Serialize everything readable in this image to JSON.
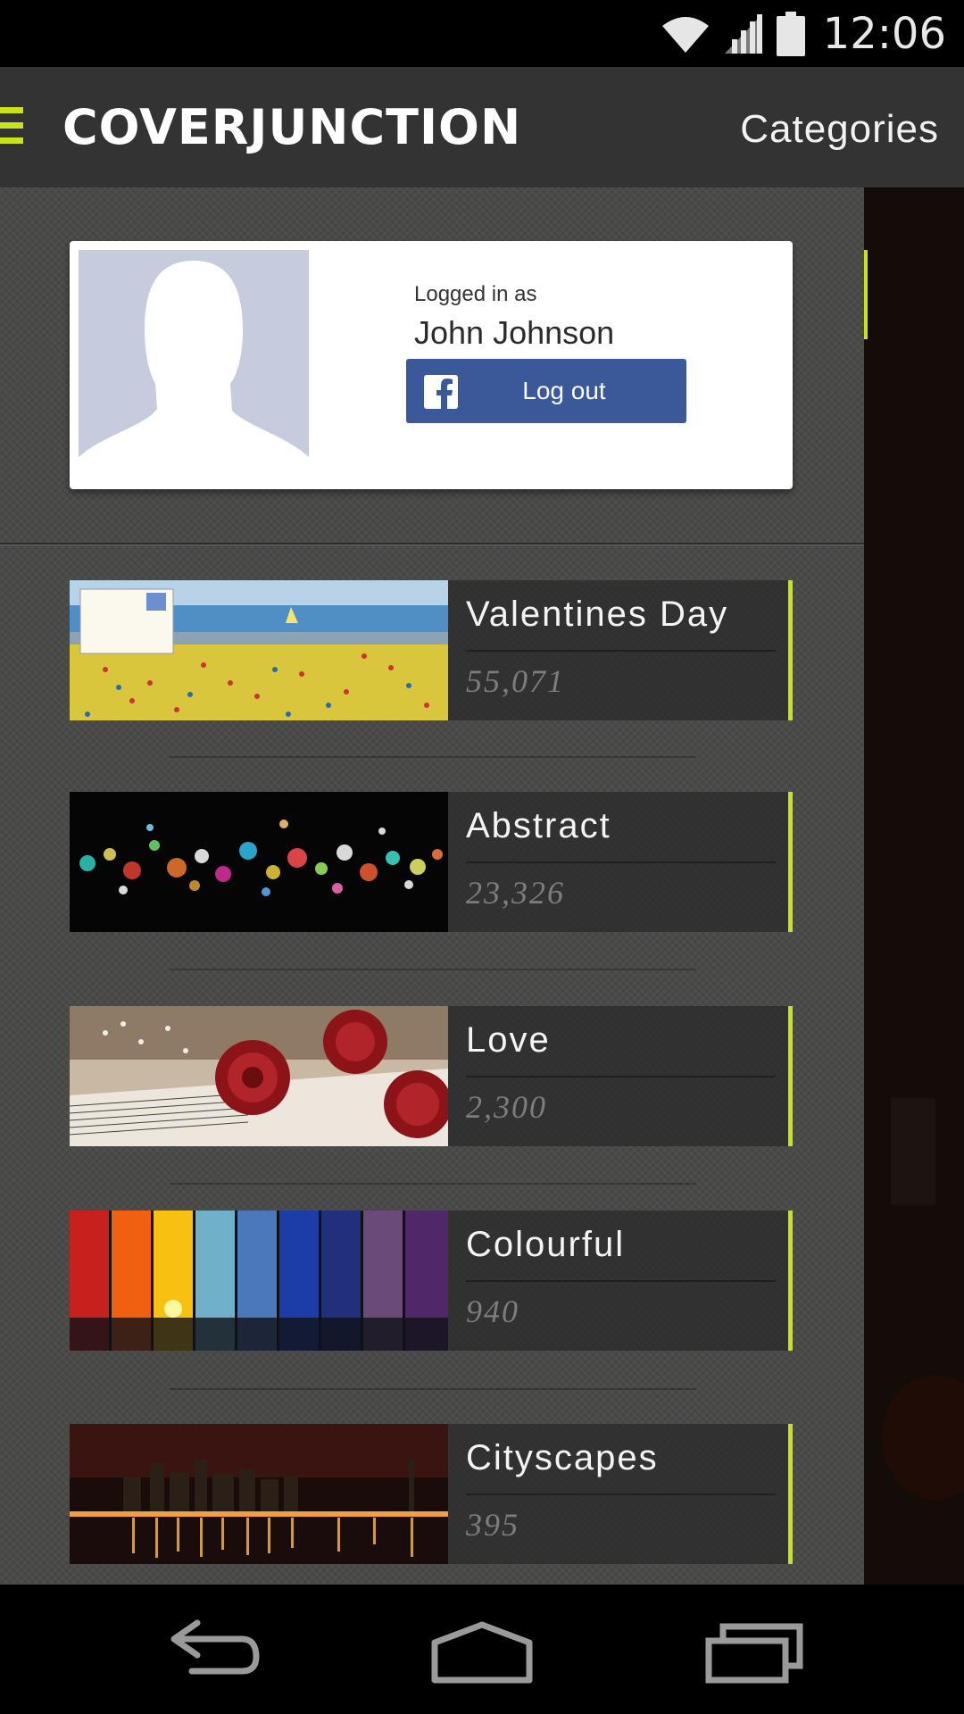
{
  "status_bar": {
    "time": "12:06",
    "icons": [
      "wifi-icon",
      "signal-icon",
      "battery-icon"
    ]
  },
  "header": {
    "logo_text": "COVERJUNCTION",
    "categories_label": "Categories"
  },
  "profile": {
    "logged_in_label": "Logged in as",
    "name": "John Johnson",
    "logout_label": "Log out",
    "facebook_color": "#3b5998"
  },
  "categories": [
    {
      "name": "Valentines Day",
      "count": "55,071"
    },
    {
      "name": "Abstract",
      "count": "23,326"
    },
    {
      "name": "Love",
      "count": "2,300"
    },
    {
      "name": "Colourful",
      "count": "940"
    },
    {
      "name": "Cityscapes",
      "count": "395"
    }
  ],
  "colors": {
    "accent": "#c9e21b",
    "action_bar": "#333333",
    "drawer": "#4a4a49"
  },
  "nav": [
    "back-icon",
    "home-icon",
    "recent-apps-icon"
  ]
}
